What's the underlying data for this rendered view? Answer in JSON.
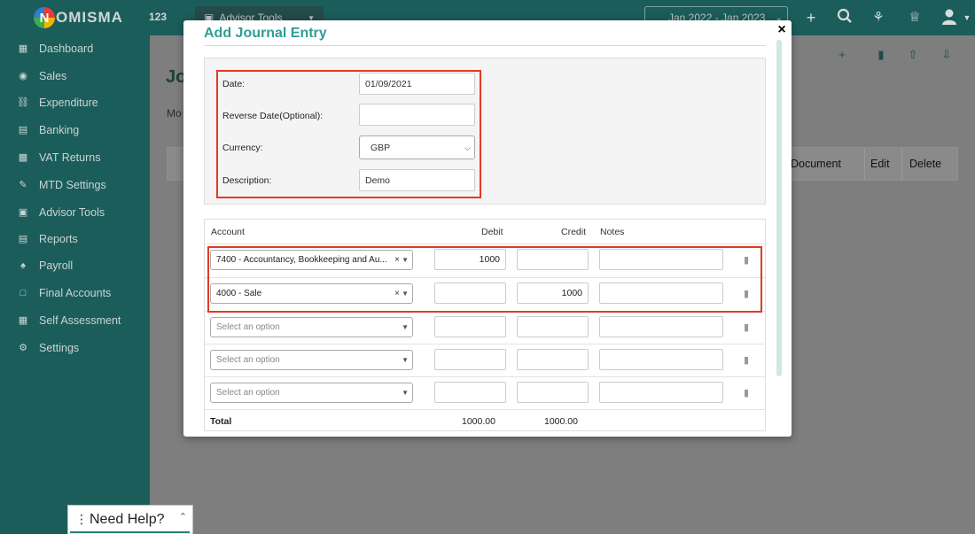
{
  "header": {
    "logo_mark": "N",
    "logo_text": "OMISMA",
    "company": "123",
    "advisor_tools_label": "Advisor Tools",
    "period_label": "Jan 2022 - Jan 2023"
  },
  "sidebar": {
    "items": [
      {
        "label": "Dashboard",
        "icon": "dashboard-icon"
      },
      {
        "label": "Sales",
        "icon": "sales-icon"
      },
      {
        "label": "Expenditure",
        "icon": "expenditure-icon"
      },
      {
        "label": "Banking",
        "icon": "bank-icon"
      },
      {
        "label": "VAT Returns",
        "icon": "vat-icon"
      },
      {
        "label": "MTD Settings",
        "icon": "mtd-icon"
      },
      {
        "label": "Advisor Tools",
        "icon": "briefcase-icon"
      },
      {
        "label": "Reports",
        "icon": "reports-icon"
      },
      {
        "label": "Payroll",
        "icon": "payroll-icon"
      },
      {
        "label": "Final Accounts",
        "icon": "final-accounts-icon"
      },
      {
        "label": "Self Assessment",
        "icon": "self-assessment-icon"
      },
      {
        "label": "Settings",
        "icon": "gear-icon"
      }
    ]
  },
  "main": {
    "title": "Jo",
    "subtitle": "Mo",
    "columns": [
      "Document",
      "Edit",
      "Delete"
    ]
  },
  "help": {
    "label": "Need Help?"
  },
  "modal": {
    "title": "Add Journal Entry",
    "close": "×",
    "form": {
      "date_label": "Date:",
      "date_value": "01/09/2021",
      "reverse_label": "Reverse Date(Optional):",
      "reverse_value": "",
      "currency_label": "Currency:",
      "currency_value": "GBP",
      "description_label": "Description:",
      "description_value": "Demo"
    },
    "lines": {
      "headers": {
        "account": "Account",
        "debit": "Debit",
        "credit": "Credit",
        "notes": "Notes"
      },
      "rows": [
        {
          "account": "7400 - Accountancy, Bookkeeping and Au...",
          "debit": "1000",
          "credit": "",
          "notes": ""
        },
        {
          "account": "4000 - Sale",
          "debit": "",
          "credit": "1000",
          "notes": ""
        },
        {
          "account": "Select an option",
          "debit": "",
          "credit": "",
          "notes": ""
        },
        {
          "account": "Select an option",
          "debit": "",
          "credit": "",
          "notes": ""
        },
        {
          "account": "Select an option",
          "debit": "",
          "credit": "",
          "notes": ""
        }
      ],
      "total_label": "Total",
      "total_debit": "1000.00",
      "total_credit": "1000.00"
    }
  },
  "colors": {
    "brand_teal": "#1b5d5a",
    "title_teal": "#2f9d94",
    "highlight_red": "#e03b24"
  }
}
